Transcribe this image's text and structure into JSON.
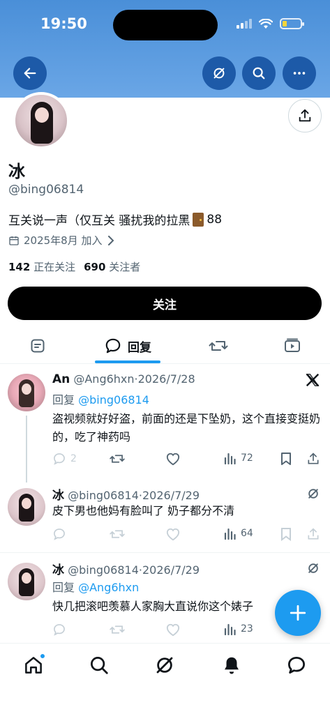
{
  "status": {
    "time": "19:50"
  },
  "profile": {
    "name": "冰",
    "handle": "@bing06814",
    "bio": "互关说一声（仅互关 骚扰我的拉黑",
    "bio_suffix": "88",
    "joined": "2025年8月 加入",
    "following_count": "142",
    "following_label": "正在关注",
    "followers_count": "690",
    "followers_label": "关注者",
    "follow_button": "关注"
  },
  "tabs": {
    "replies_label": "回复"
  },
  "posts": [
    {
      "author": "An",
      "handle": "@Ang6hxn",
      "date": "·2026/7/28",
      "reply_prefix": "回复",
      "reply_to": "@bing06814",
      "text": "盗视频就好好盗，前面的还是下坠奶，这个直接变挺奶的，吃了神药吗",
      "replies": "2",
      "views": "72"
    },
    {
      "author": "冰",
      "handle": "@bing06814",
      "date": "·2026/7/29",
      "text": "皮下男也他妈有脸叫了 奶子都分不清",
      "views": "64"
    },
    {
      "author": "冰",
      "handle": "@bing06814",
      "date": "·2026/7/29",
      "reply_prefix": "回复",
      "reply_to": "@Ang6hxn",
      "text": "快几把滚吧羡慕人家胸大直说你这个婊子",
      "views": "23"
    }
  ],
  "colors": {
    "accent": "#1d9bf0",
    "banner": "#4a8fd8"
  },
  "icons": [
    "back-arrow-icon",
    "grok-icon",
    "search-icon",
    "more-icon",
    "share-icon",
    "calendar-icon",
    "chevron-right-icon",
    "x-logo-icon",
    "reply-icon",
    "retweet-icon",
    "like-icon",
    "views-icon",
    "bookmark-icon",
    "home-icon",
    "bell-icon",
    "messages-icon",
    "plus-icon"
  ]
}
